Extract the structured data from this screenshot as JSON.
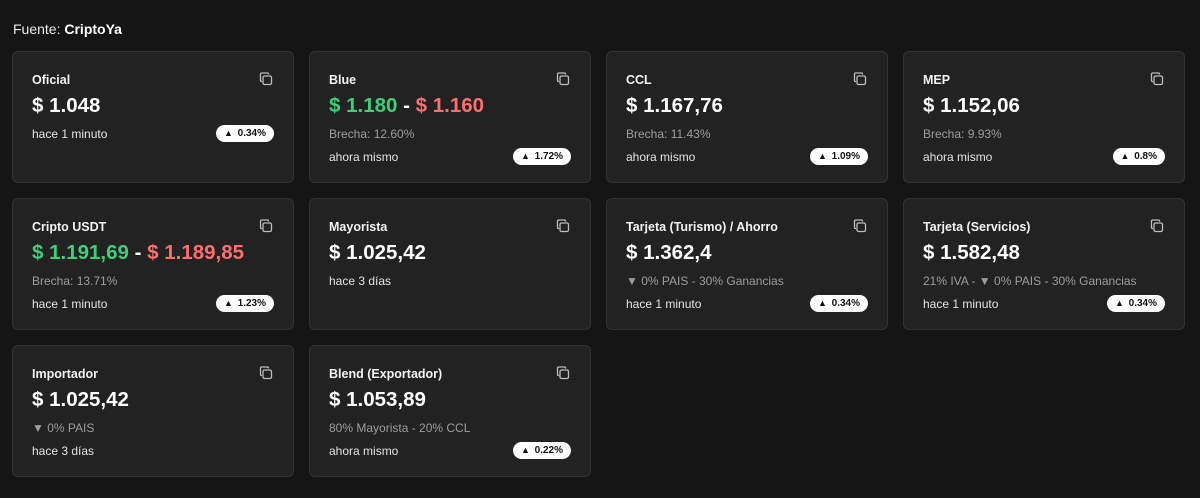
{
  "source": {
    "prefix": "Fuente:",
    "name": "CriptoYa"
  },
  "colors": {
    "buy": "#3dd07a",
    "sell": "#ff6e6e",
    "background": "#151515",
    "card": "#222222"
  },
  "cards": [
    {
      "title": "Oficial",
      "price": "$ 1.048",
      "time": "hace 1 minuto",
      "change": "0.34%",
      "change_icon": "triangle-up-icon"
    },
    {
      "title": "Blue",
      "buy": "$ 1.180",
      "separator": "-",
      "sell": "$ 1.160",
      "subtitle": "Brecha: 12.60%",
      "time": "ahora mismo",
      "change": "1.72%",
      "change_icon": "triangle-up-icon"
    },
    {
      "title": "CCL",
      "price": "$ 1.167,76",
      "subtitle": "Brecha: 11.43%",
      "time": "ahora mismo",
      "change": "1.09%",
      "change_icon": "triangle-up-icon"
    },
    {
      "title": "MEP",
      "price": "$ 1.152,06",
      "subtitle": "Brecha: 9.93%",
      "time": "ahora mismo",
      "change": "0.8%",
      "change_icon": "triangle-up-icon"
    },
    {
      "title": "Cripto USDT",
      "buy": "$ 1.191,69",
      "separator": "-",
      "sell": "$ 1.189,85",
      "subtitle": "Brecha: 13.71%",
      "time": "hace 1 minuto",
      "change": "1.23%",
      "change_icon": "triangle-up-icon"
    },
    {
      "title": "Mayorista",
      "price": "$ 1.025,42",
      "time": "hace 3 días"
    },
    {
      "title": "Tarjeta (Turismo) / Ahorro",
      "price": "$ 1.362,4",
      "subtitle": "▼ 0% PAIS - 30% Ganancias",
      "time": "hace 1 minuto",
      "change": "0.34%",
      "change_icon": "triangle-up-icon"
    },
    {
      "title": "Tarjeta (Servicios)",
      "price": "$ 1.582,48",
      "subtitle": "21% IVA - ▼ 0% PAIS - 30% Ganancias",
      "time": "hace 1 minuto",
      "change": "0.34%",
      "change_icon": "triangle-up-icon"
    },
    {
      "title": "Importador",
      "price": "$ 1.025,42",
      "subtitle": "▼ 0% PAIS",
      "time": "hace 3 días"
    },
    {
      "title": "Blend (Exportador)",
      "price": "$ 1.053,89",
      "subtitle": "80% Mayorista - 20% CCL",
      "time": "ahora mismo",
      "change": "0.22%",
      "change_icon": "triangle-up-icon"
    }
  ],
  "copy_icon": "copy-icon"
}
